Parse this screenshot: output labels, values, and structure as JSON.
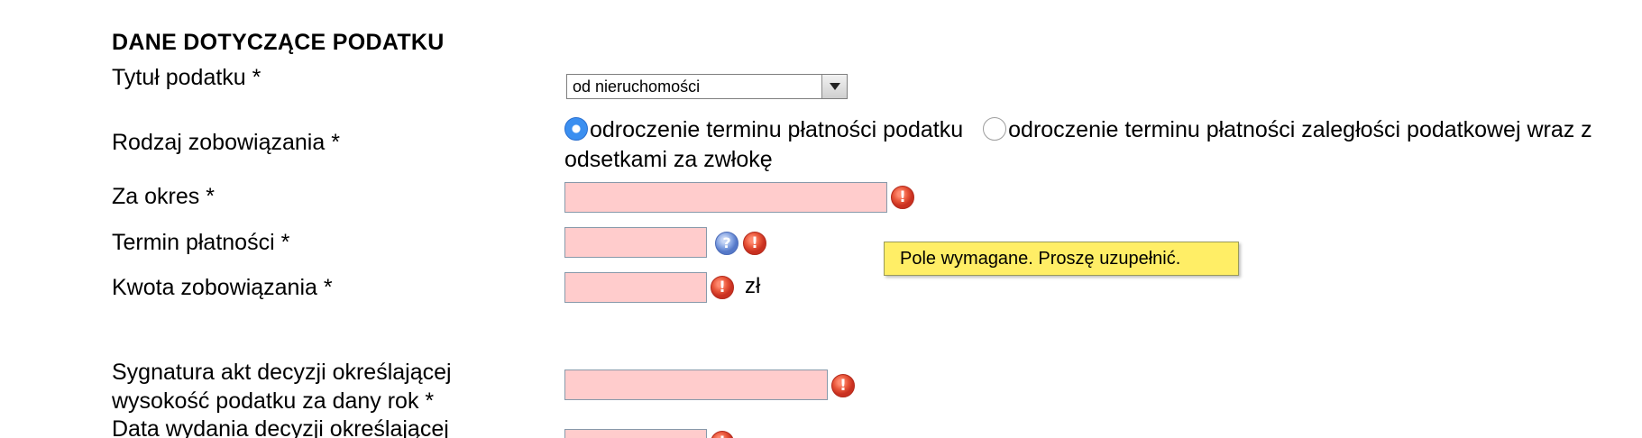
{
  "section": {
    "title": "DANE DOTYCZĄCE PODATKU"
  },
  "fields": {
    "tax_title": {
      "label": "Tytuł podatku *",
      "selected": "od nieruchomości"
    },
    "obligation_type": {
      "label": "Rodzaj zobowiązania *",
      "options": [
        "odroczenie terminu płatności podatku",
        "odroczenie terminu płatności zaległości podatkowej wraz z odsetkami za zwłokę"
      ],
      "selected_index": 0
    },
    "period": {
      "label": "Za okres *",
      "value": ""
    },
    "payment_deadline": {
      "label": "Termin płatności *",
      "value": ""
    },
    "amount": {
      "label": "Kwota zobowiązania *",
      "value": "",
      "unit": "zł"
    },
    "decision_signature": {
      "label_line1": "Sygnatura akt decyzji określającej",
      "label_line2": "wysokość podatku za dany rok *",
      "value": ""
    },
    "decision_date": {
      "label_line1": "Data wydania decyzji określającej",
      "value": ""
    }
  },
  "tooltip": {
    "text": "Pole wymagane. Proszę uzupełnić."
  },
  "icons": {
    "error": "error-icon",
    "help": "help-icon"
  },
  "colors": {
    "invalid_field_bg": "#ffcccc",
    "tooltip_bg": "#ffee66",
    "error_icon": "#d94430",
    "help_icon": "#6f8fd8",
    "radio_selected": "#3b8ff0"
  }
}
